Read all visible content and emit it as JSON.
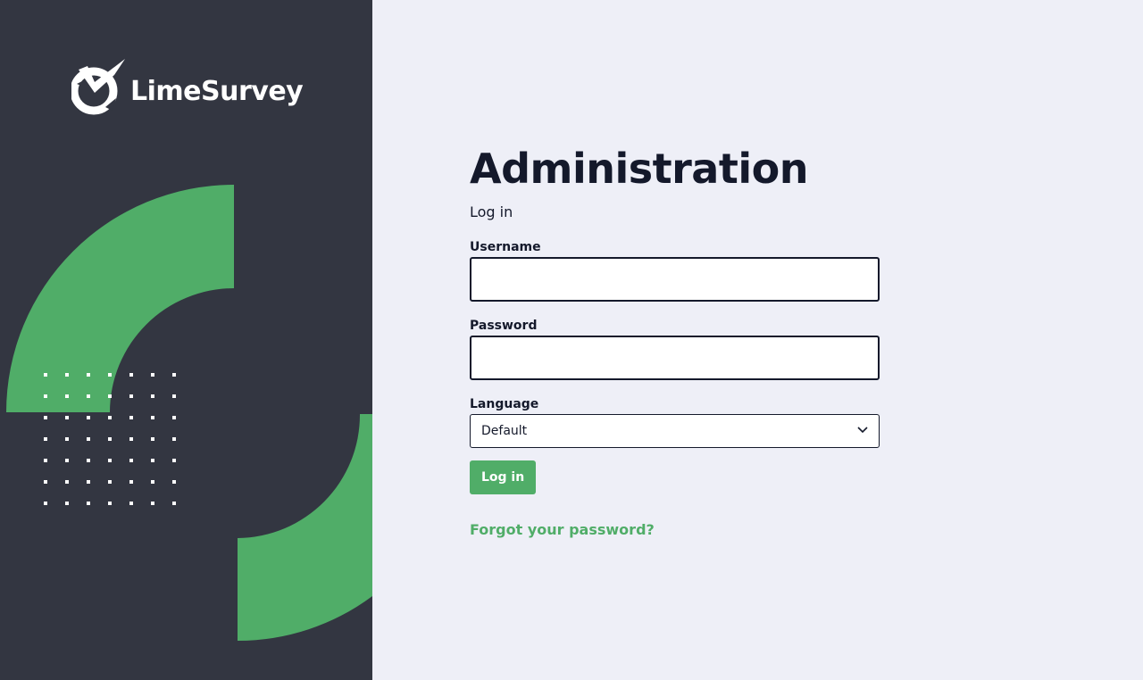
{
  "brand": {
    "name": "LimeSurvey",
    "accent_color": "#50ad68",
    "dark_color": "#333641",
    "logo_icon": "limesurvey-logo-icon"
  },
  "page": {
    "title": "Administration",
    "subtitle": "Log in"
  },
  "form": {
    "username_label": "Username",
    "username_value": "",
    "password_label": "Password",
    "password_value": "",
    "language_label": "Language",
    "language_selected": "Default",
    "login_button": "Log in",
    "forgot_link": "Forgot your password?"
  }
}
